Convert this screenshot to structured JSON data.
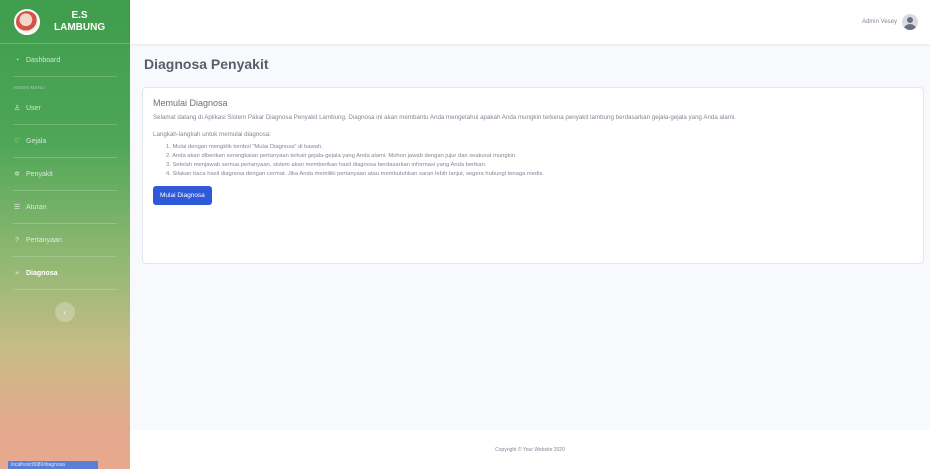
{
  "brand": {
    "line1": "E.S",
    "line2": "LAMBUNG"
  },
  "sidebar": {
    "dashboard": "Dashboard",
    "heading": "ADMIN MENU",
    "items": [
      {
        "label": "User",
        "icon": "user-icon",
        "glyph": "♙"
      },
      {
        "label": "Gejala",
        "icon": "heart-icon",
        "glyph": "♡"
      },
      {
        "label": "Penyakit",
        "icon": "virus-icon",
        "glyph": "✲"
      },
      {
        "label": "Aturan",
        "icon": "list-icon",
        "glyph": "☰"
      },
      {
        "label": "Pertanyaan",
        "icon": "question-icon",
        "glyph": "?"
      },
      {
        "label": "Diagnosa",
        "icon": "stethoscope-icon",
        "glyph": "♅"
      }
    ],
    "toggle_glyph": "‹",
    "bottom_tag": "localhost:8080/diagnosa"
  },
  "topbar": {
    "user_name": "Admin Vesey"
  },
  "page": {
    "title": "Diagnosa Penyakit"
  },
  "card": {
    "title": "Memulai Diagnosa",
    "intro": "Selamat datang di Aplikasi Sistem Pakar Diagnosa Penyakit Lambung. Diagnosa ini akan membantu Anda mengetahui apakah Anda mungkin terkena penyakit lambung berdasarkan gejala-gejala yang Anda alami.",
    "steps_intro": "Langkah-langkah untuk memulai diagnosa:",
    "steps": [
      "1. Mulai dengan mengklik tombol \"Mulai Diagnosa\" di bawah.",
      "2. Anda akan diberikan serangkaian pertanyaan terkait gejala-gejala yang Anda alami. Mohon jawab dengan jujur dan seakurat mungkin.",
      "3. Setelah menjawab semua pertanyaan, sistem akan memberikan hasil diagnosa berdasarkan informasi yang Anda berikan.",
      "4. Silakan baca hasil diagnosa dengan cermat. Jika Anda memiliki pertanyaan atau membutuhkan saran lebih lanjut, segera hubungi tenaga medis."
    ],
    "button": "Mulai Diagnosa"
  },
  "footer": {
    "text": "Copyright © Your Website 2020"
  },
  "colors": {
    "primary": "#2e59d9",
    "sidebar_top": "#3f9d4d",
    "sidebar_bottom": "#e7a98f"
  }
}
